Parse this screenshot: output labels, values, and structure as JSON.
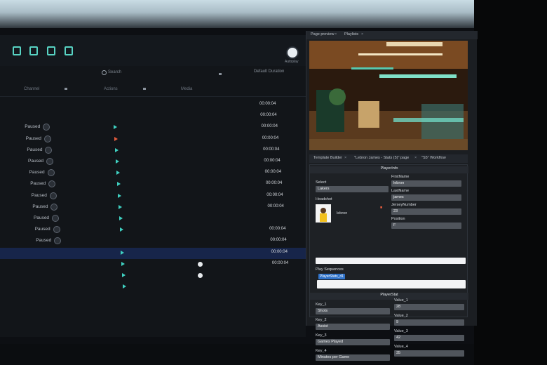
{
  "toolbar": {
    "toggle_label": "Autoplay"
  },
  "search": {
    "label": "Search"
  },
  "header": {
    "default_duration": "Default Duration"
  },
  "columns": {
    "channel": "Channel",
    "actions": "Actions",
    "media": "Media"
  },
  "rows": [
    {
      "status": "",
      "duration": "00:00:04",
      "play": ""
    },
    {
      "status": "",
      "duration": "00:00:04",
      "play": ""
    },
    {
      "status": "Paused",
      "duration": "00:00:04",
      "play": "teal"
    },
    {
      "status": "Paused",
      "duration": "00:00:04",
      "play": "red"
    },
    {
      "status": "Paused",
      "duration": "00:00:04",
      "play": "teal"
    },
    {
      "status": "Paused",
      "duration": "00:00:04",
      "play": "teal"
    },
    {
      "status": "Paused",
      "duration": "00:00:04",
      "play": "teal"
    },
    {
      "status": "Paused",
      "duration": "00:00:04",
      "play": "teal"
    },
    {
      "status": "Paused",
      "duration": "00:00:04",
      "play": "teal"
    },
    {
      "status": "Paused",
      "duration": "00:00:04",
      "play": "teal"
    },
    {
      "status": "Paused",
      "duration": "",
      "play": "teal"
    },
    {
      "status": "Paused",
      "duration": "00:00:04",
      "play": "teal"
    },
    {
      "status": "Paused",
      "duration": "00:00:04",
      "play": ""
    },
    {
      "status": "",
      "duration": "00:00:04",
      "play": "teal"
    },
    {
      "status": "",
      "duration": "00:00:04",
      "play": "teal"
    },
    {
      "status": "",
      "duration": "",
      "play": "teal"
    },
    {
      "status": "",
      "duration": "",
      "play": "teal"
    }
  ],
  "panes": {
    "tab_page_preview": "Page preview",
    "tab_playlists": "Playlists",
    "tab_template_builder": "Template Builder",
    "tab_state_page": "\"Lebron James - Stats (5)\" page",
    "tab_workflow": "\"S5\" Workflow"
  },
  "playerinfo": {
    "title": "PlayerInfo",
    "select_label": "Select",
    "select_value": "Lakers",
    "headshot_label": "Headshot",
    "headshot_name": "lebron",
    "firstname_label": "FirstName",
    "firstname_value": "lebron",
    "lastname_label": "LastName",
    "lastname_value": "james",
    "jersey_label": "JerseyNumber",
    "jersey_value": "23",
    "position_label": "Position",
    "position_value": "F",
    "sequences_label": "Play Sequences",
    "sequence_chip": "PlayerStats_d1"
  },
  "playerstat": {
    "title": "PlayerStat",
    "keys": [
      {
        "label": "Key_1",
        "value": "Shots"
      },
      {
        "label": "Key_2",
        "value": "Assist"
      },
      {
        "label": "Key_3",
        "value": "Games Played"
      },
      {
        "label": "Key_4",
        "value": "Minutes per Game"
      }
    ],
    "values": [
      {
        "label": "Value_1",
        "value": "28"
      },
      {
        "label": "Value_2",
        "value": "9"
      },
      {
        "label": "Value_3",
        "value": "42"
      },
      {
        "label": "Value_4",
        "value": "35"
      }
    ]
  },
  "colors": {
    "accent": "#3fd0c1",
    "selection": "#17254a",
    "panel": "#121519",
    "record": "#e25b3d"
  }
}
